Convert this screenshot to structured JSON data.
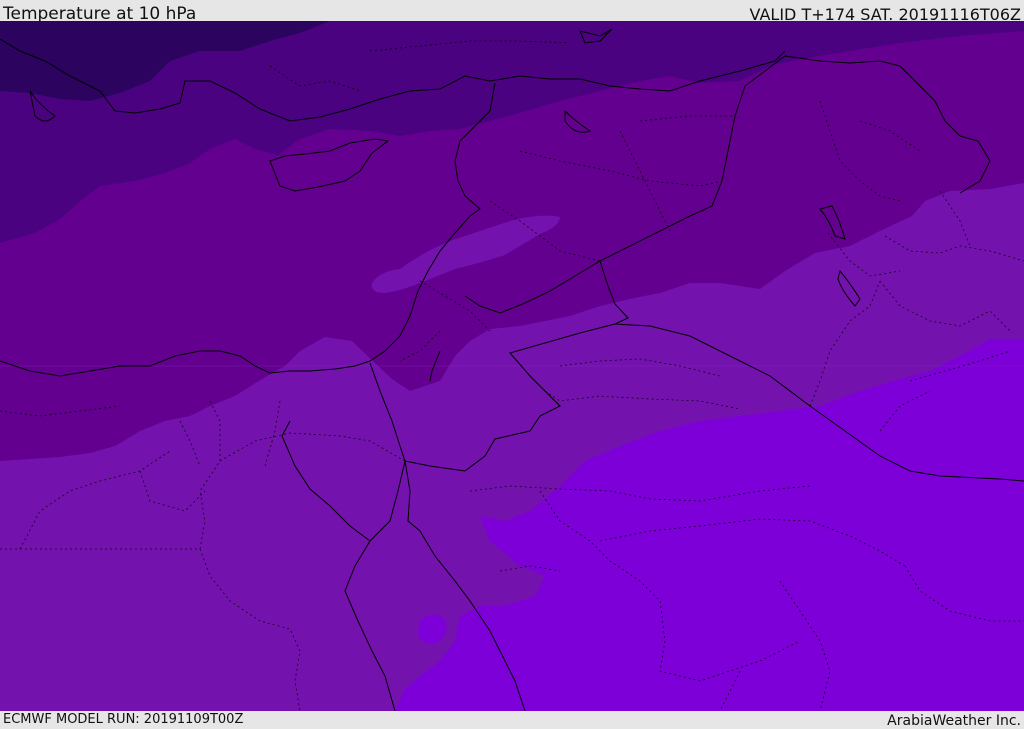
{
  "header": {
    "title": "Temperature at 10 hPa",
    "valid_time": "VALID T+174 SAT. 20191116T06Z"
  },
  "footer": {
    "model_run": "ECMWF MODEL RUN: 20191109T00Z",
    "credit": "ArabiaWeather Inc."
  },
  "map": {
    "field": "temperature",
    "level": "10 hPa",
    "palette": {
      "coldest": "#2c0460",
      "colder": "#4b0280",
      "cold": "#64008f",
      "mid": "#7412ae",
      "warm": "#7d00d9"
    },
    "border_color": "#000000"
  }
}
